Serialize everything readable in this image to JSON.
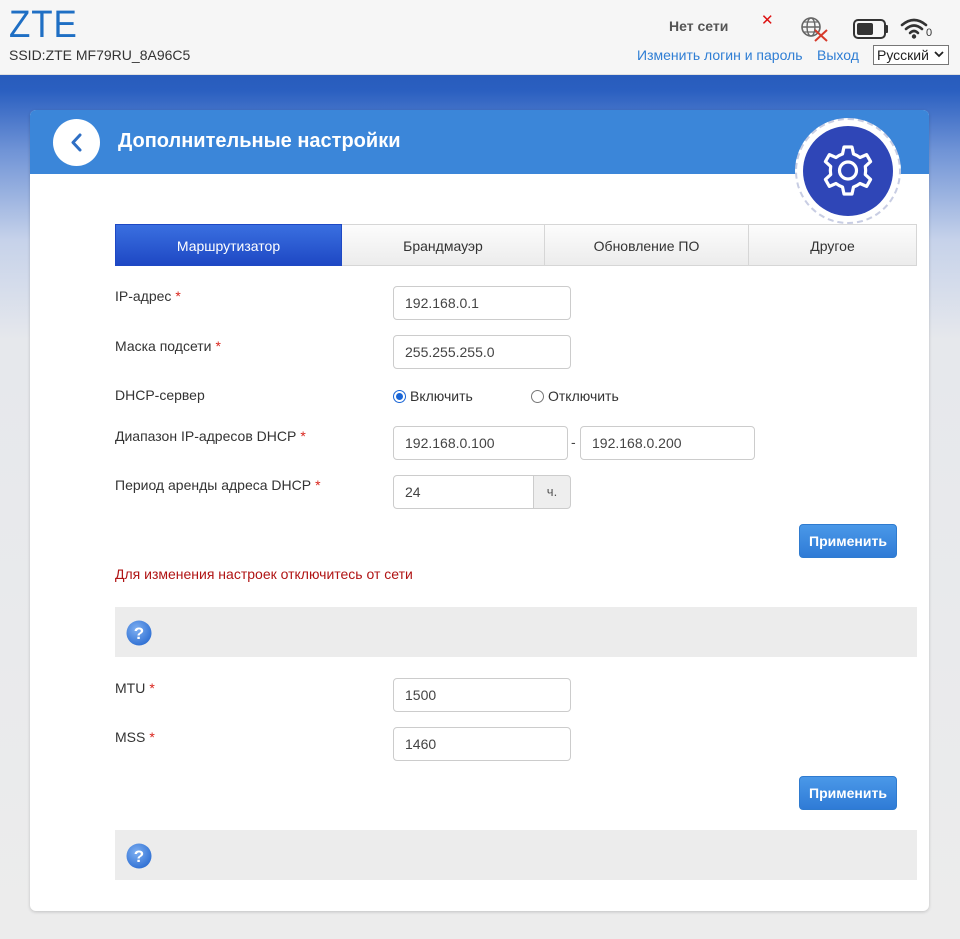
{
  "header": {
    "logo": "ZTE",
    "ssid": "SSID:ZTE MF79RU_8A96C5",
    "network_status": "Нет сети",
    "wifi_clients": "0",
    "change_login_link": "Изменить логин и пароль",
    "logout_link": "Выход",
    "language": "Русский",
    "icons": [
      "signal-x-icon",
      "globe-disconnected-icon",
      "battery-icon",
      "wifi-icon",
      "chevron-down-icon"
    ]
  },
  "page": {
    "title": "Дополнительные настройки",
    "icons": [
      "back-arrow-icon",
      "gear-icon"
    ]
  },
  "tabs": [
    {
      "label": "Маршрутизатор",
      "active": true
    },
    {
      "label": "Брандмауэр",
      "active": false
    },
    {
      "label": "Обновление ПО",
      "active": false
    },
    {
      "label": "Другое",
      "active": false
    }
  ],
  "router_form": {
    "ip_label": "IP-адрес",
    "ip_value": "192.168.0.1",
    "mask_label": "Маска подсети",
    "mask_value": "255.255.255.0",
    "dhcp_label": "DHCP-сервер",
    "dhcp_enable": "Включить",
    "dhcp_disable": "Отключить",
    "dhcp_selected": "Включить",
    "range_label": "Диапазон IP-адресов DHCP",
    "range_start": "192.168.0.100",
    "range_sep": "-",
    "range_end": "192.168.0.200",
    "lease_label": "Период аренды адреса DHCP",
    "lease_value": "24",
    "lease_unit": "ч.",
    "required_mark": "*",
    "apply": "Применить",
    "warning": "Для изменения настроек отключитесь от сети"
  },
  "mtu_form": {
    "mtu_label": "MTU",
    "mtu_value": "1500",
    "mss_label": "MSS",
    "mss_value": "1460",
    "apply": "Применить"
  },
  "help_icon": "help-question-icon",
  "colors": {
    "brand_blue": "#1f6fc4",
    "header_blue": "#3b86d9",
    "tab_active": "#1e48c4",
    "button_blue": "#2f7bd6",
    "warning_red": "#b01414",
    "required_red": "#d9241c"
  }
}
